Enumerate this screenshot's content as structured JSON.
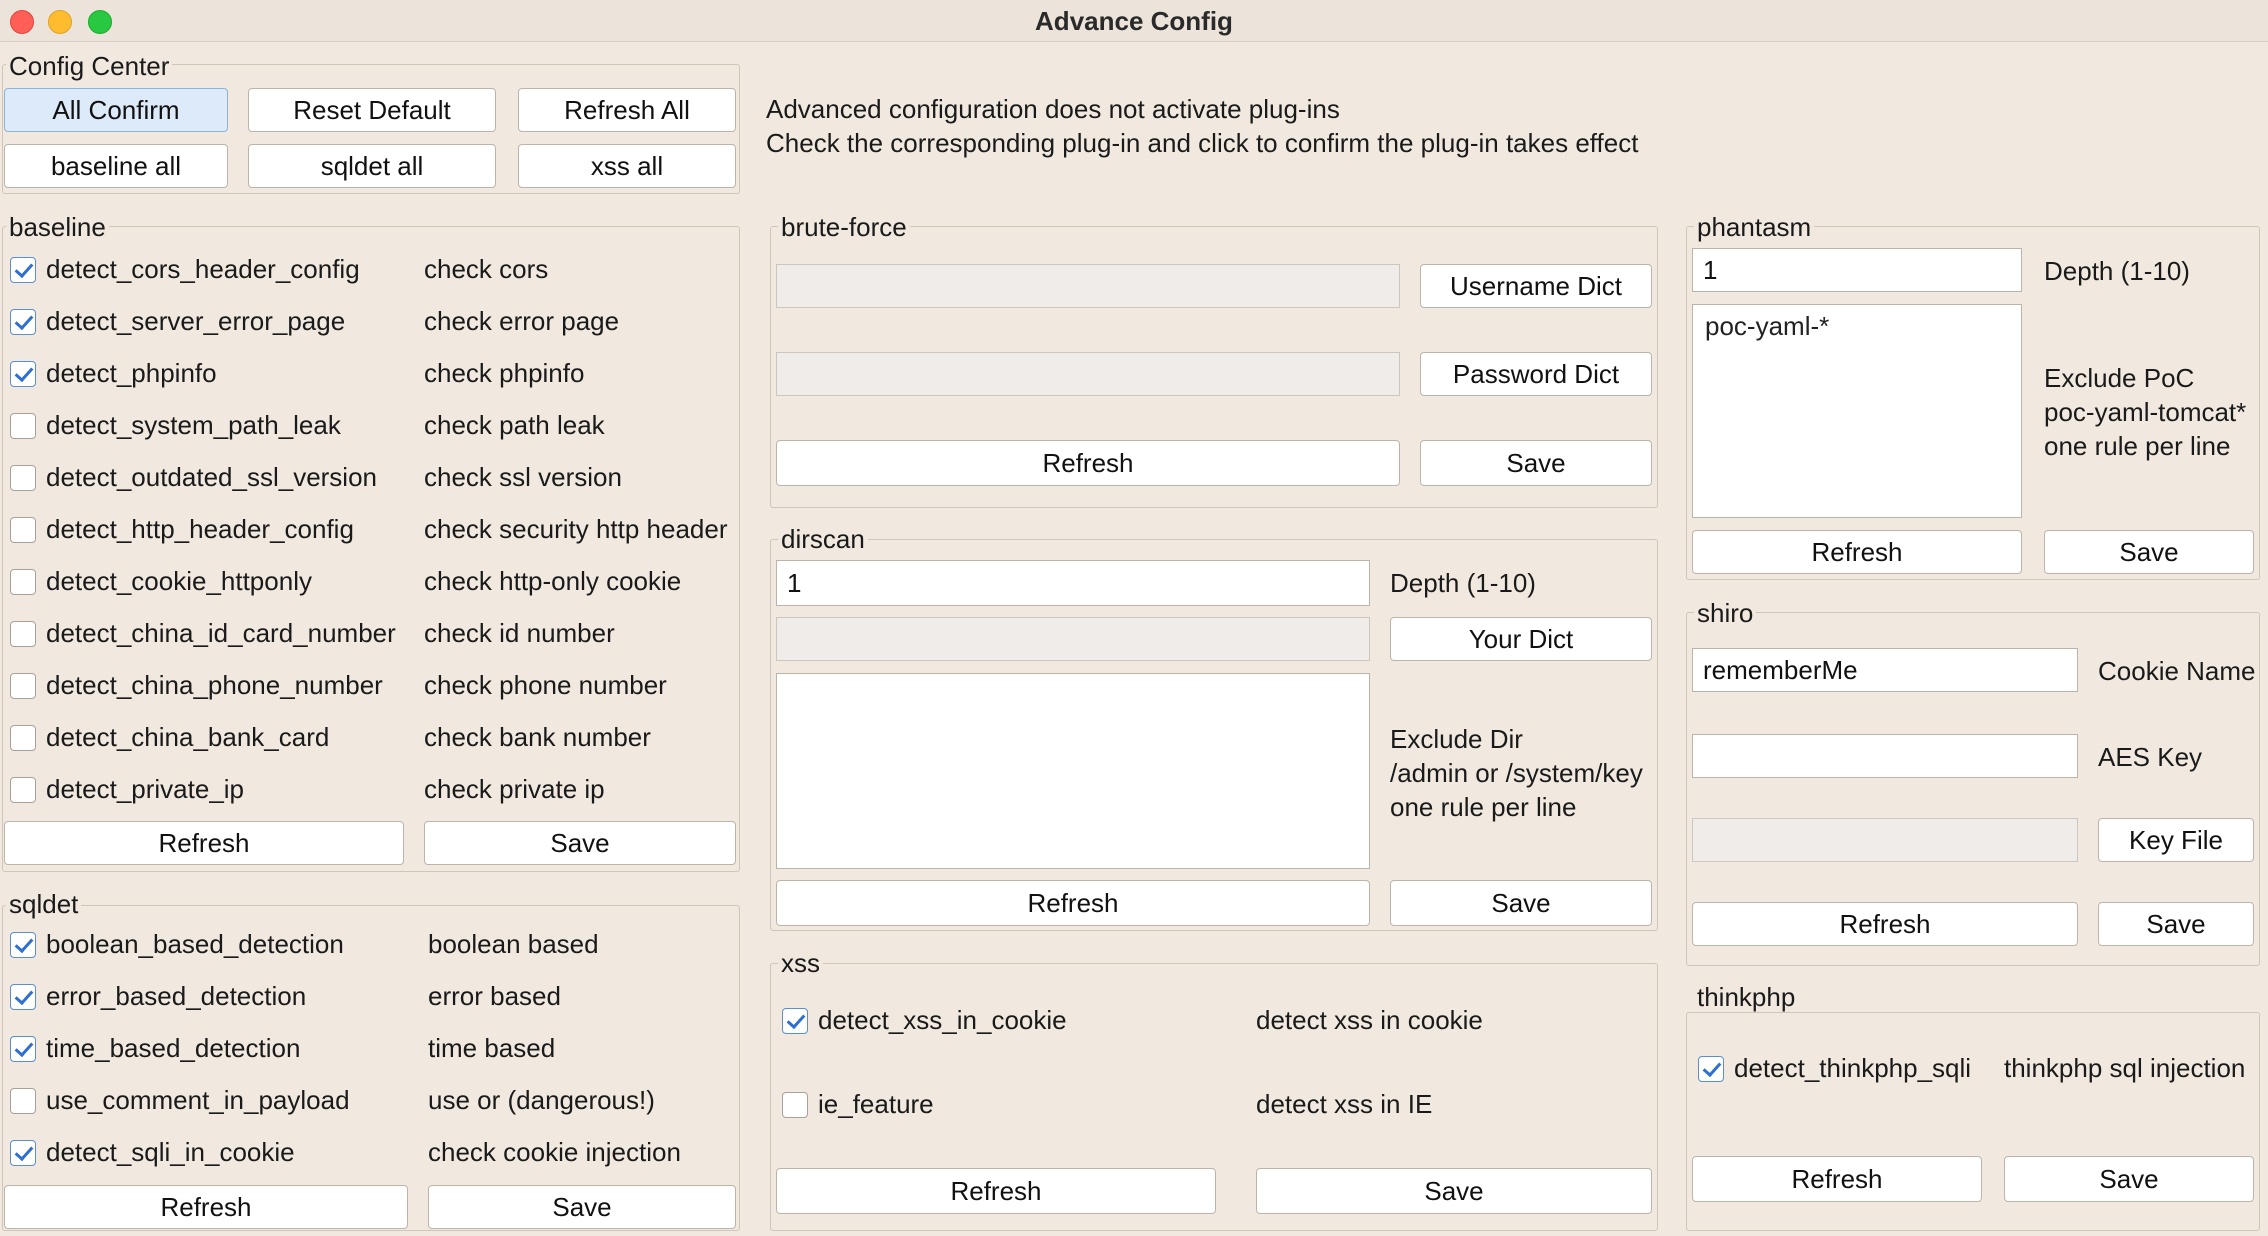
{
  "window": {
    "title": "Advance Config"
  },
  "config_center": {
    "label": "Config Center",
    "all_confirm": "All Confirm",
    "reset_default": "Reset Default",
    "refresh_all": "Refresh All",
    "baseline_all": "baseline all",
    "sqldet_all": "sqldet all",
    "xss_all": "xss all"
  },
  "info": {
    "line1": "Advanced configuration does not activate plug-ins",
    "line2": "Check the corresponding plug-in and click to confirm the plug-in takes effect"
  },
  "baseline": {
    "label": "baseline",
    "items": [
      {
        "name": "detect_cors_header_config",
        "desc": "check cors",
        "checked": true
      },
      {
        "name": "detect_server_error_page",
        "desc": "check error page",
        "checked": true
      },
      {
        "name": "detect_phpinfo",
        "desc": "check phpinfo",
        "checked": true
      },
      {
        "name": "detect_system_path_leak",
        "desc": "check path leak",
        "checked": false
      },
      {
        "name": "detect_outdated_ssl_version",
        "desc": "check ssl version",
        "checked": false
      },
      {
        "name": "detect_http_header_config",
        "desc": "check security http header",
        "checked": false
      },
      {
        "name": "detect_cookie_httponly",
        "desc": "check http-only cookie",
        "checked": false
      },
      {
        "name": "detect_china_id_card_number",
        "desc": "check id number",
        "checked": false
      },
      {
        "name": "detect_china_phone_number",
        "desc": "check phone number",
        "checked": false
      },
      {
        "name": "detect_china_bank_card",
        "desc": "check bank number",
        "checked": false
      },
      {
        "name": "detect_private_ip",
        "desc": "check private ip",
        "checked": false
      }
    ],
    "refresh": "Refresh",
    "save": "Save"
  },
  "sqldet": {
    "label": "sqldet",
    "items": [
      {
        "name": "boolean_based_detection",
        "desc": "boolean based",
        "checked": true
      },
      {
        "name": "error_based_detection",
        "desc": "error based",
        "checked": true
      },
      {
        "name": "time_based_detection",
        "desc": "time based",
        "checked": true
      },
      {
        "name": "use_comment_in_payload",
        "desc": "use or (dangerous!)",
        "checked": false
      },
      {
        "name": "detect_sqli_in_cookie",
        "desc": "check cookie injection",
        "checked": true
      }
    ],
    "refresh": "Refresh",
    "save": "Save"
  },
  "brute_force": {
    "label": "brute-force",
    "username_value": "",
    "password_value": "",
    "username_dict": "Username Dict",
    "password_dict": "Password Dict",
    "refresh": "Refresh",
    "save": "Save"
  },
  "dirscan": {
    "label": "dirscan",
    "depth_value": "1",
    "depth_label": "Depth (1-10)",
    "dict_value": "",
    "your_dict": "Your Dict",
    "exclude_value": "",
    "exclude_line1": "Exclude Dir",
    "exclude_line2": "/admin or /system/key",
    "exclude_line3": "one rule per line",
    "refresh": "Refresh",
    "save": "Save"
  },
  "xss": {
    "label": "xss",
    "items": [
      {
        "name": "detect_xss_in_cookie",
        "desc": "detect xss in cookie",
        "checked": true
      },
      {
        "name": "ie_feature",
        "desc": "detect xss in IE",
        "checked": false
      }
    ],
    "refresh": "Refresh",
    "save": "Save"
  },
  "phantasm": {
    "label": "phantasm",
    "depth_value": "1",
    "depth_label": "Depth (1-10)",
    "exclude_value": "poc-yaml-*",
    "exclude_line1": "Exclude PoC",
    "exclude_line2": "poc-yaml-tomcat*",
    "exclude_line3": "one rule per line",
    "refresh": "Refresh",
    "save": "Save"
  },
  "shiro": {
    "label": "shiro",
    "cookie_value": "rememberMe",
    "cookie_label": "Cookie Name",
    "aes_value": "",
    "aes_label": "AES Key",
    "keyfile_value": "",
    "key_file": "Key File",
    "refresh": "Refresh",
    "save": "Save"
  },
  "thinkphp": {
    "label": "thinkphp",
    "items": [
      {
        "name": "detect_thinkphp_sqli",
        "desc": "thinkphp sql injection",
        "checked": true
      }
    ],
    "refresh": "Refresh",
    "save": "Save"
  }
}
